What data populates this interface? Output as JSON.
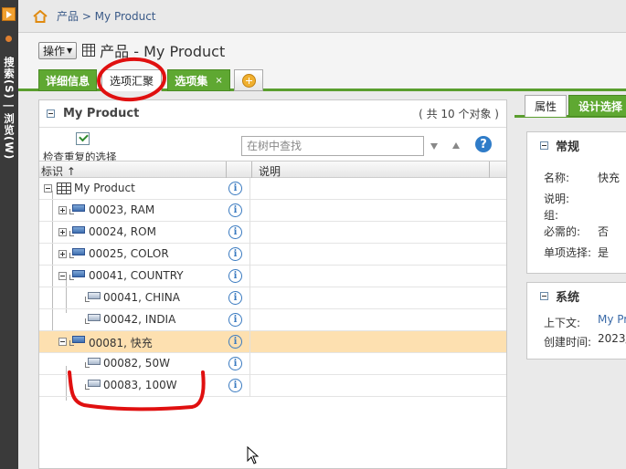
{
  "rail": {
    "label": "搜索(S) | 浏览(W)"
  },
  "breadcrumb": {
    "path": "产品 > My Product"
  },
  "header": {
    "ops_label": "操作",
    "title": "产品 - My Product"
  },
  "tabs": [
    {
      "label": "详细信息"
    },
    {
      "label": "选项汇聚"
    },
    {
      "label": "选项集",
      "close": "×"
    }
  ],
  "left_panel": {
    "title": "My Product",
    "count": "( 共 10 个对象 )",
    "dup_check_label": "检查重复的选择",
    "search_placeholder": "在树中查找",
    "help": "?",
    "columns": {
      "id": "标识 ↑",
      "desc": "说明"
    },
    "rows": [
      {
        "name": "My Product"
      },
      {
        "name": "00023, RAM"
      },
      {
        "name": "00024, ROM"
      },
      {
        "name": "00025, COLOR"
      },
      {
        "name": "00041, COUNTRY"
      },
      {
        "name": "00041, CHINA"
      },
      {
        "name": "00042, INDIA"
      },
      {
        "name": "00081, 快充"
      },
      {
        "name": "00082, 50W"
      },
      {
        "name": "00083, 100W"
      }
    ],
    "info_glyph": "i"
  },
  "right_panel": {
    "tabs": {
      "props": "属性",
      "design": "设计选择"
    },
    "general": {
      "title": "常规",
      "name_label": "名称:",
      "name_value": "快充",
      "desc_label": "说明:",
      "group_label": "组:",
      "required_label": "必需的:",
      "required_value": "否",
      "single_label": "单项选择:",
      "single_value": "是"
    },
    "system": {
      "title": "系统",
      "context_label": "上下文:",
      "context_value": "My Pr",
      "created_label": "创建时间:",
      "created_value": "2023/"
    }
  },
  "colors": {
    "accent_green": "#5fa832",
    "selected_row": "#fde0b0",
    "annotation_red": "#e01010"
  }
}
